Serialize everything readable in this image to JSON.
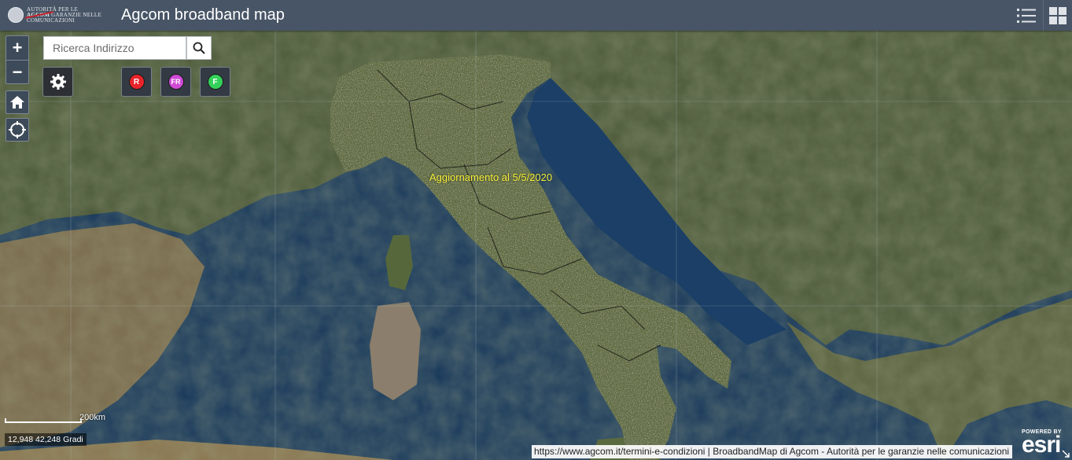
{
  "header": {
    "logo": {
      "line1": "AUTORITÀ PER LE",
      "line2": "GARANZIE NELLE",
      "brand": "AGCOM",
      "line3": "COMUNICAZIONI"
    },
    "title": "Agcom broadband map",
    "icons": [
      "list-icon",
      "grid-icon"
    ]
  },
  "map": {
    "zoom_in": "+",
    "zoom_out": "−",
    "nav_icons": [
      "home-icon",
      "locate-icon"
    ],
    "search": {
      "placeholder": "Ricerca Indirizzo",
      "value": ""
    },
    "layer_buttons": [
      {
        "label": "R",
        "color": "#e8232a"
      },
      {
        "label": "FR",
        "color": "#d04ad6"
      },
      {
        "label": "F",
        "color": "#34d15a"
      }
    ],
    "update_label": "Aggiornamento al 5/5/2020",
    "scale_label": "200km",
    "coordinates": "12,948 42,248 Gradi",
    "attribution": "https://www.agcom.it/termini-e-condizioni | BroadbandMap di Agcom - Autorità per le garanzie nelle comunicazioni",
    "powered_by": "POWERED BY",
    "esri": "esri",
    "colors": {
      "sea": "#14304f",
      "land": "#4a5836",
      "coverage": "#e8a7c6",
      "header": "#485566"
    }
  }
}
